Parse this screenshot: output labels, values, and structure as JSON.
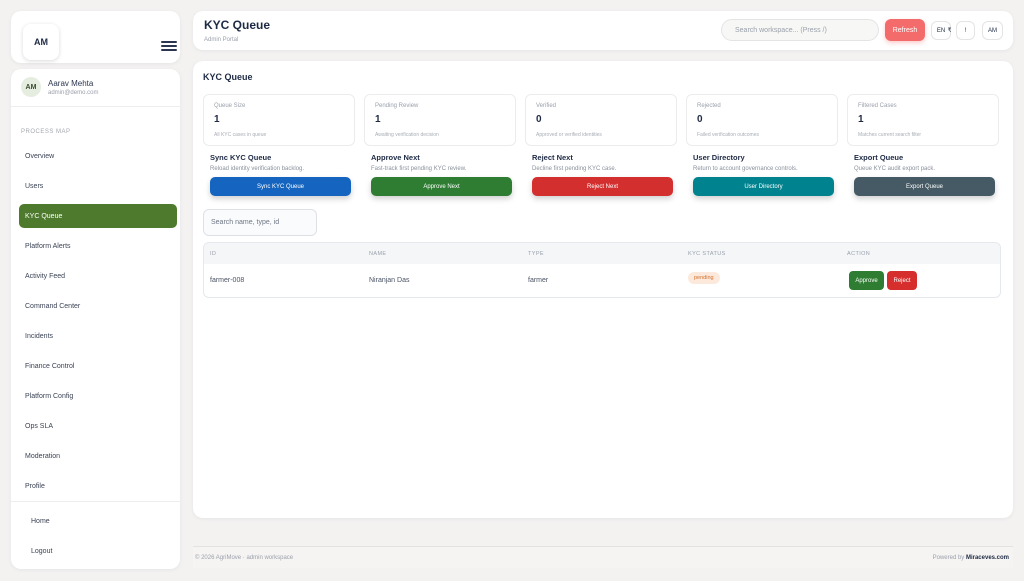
{
  "brand": {
    "logo_text": "AM"
  },
  "user": {
    "initials": "AM",
    "name": "Aarav Mehta",
    "email": "admin@demo.com"
  },
  "sidebar": {
    "section_label": "PROCESS MAP",
    "items": [
      {
        "label": "Overview"
      },
      {
        "label": "Users"
      },
      {
        "label": "KYC Queue"
      },
      {
        "label": "Platform Alerts"
      },
      {
        "label": "Activity Feed"
      },
      {
        "label": "Command Center"
      },
      {
        "label": "Incidents"
      },
      {
        "label": "Finance Control"
      },
      {
        "label": "Platform Config"
      },
      {
        "label": "Ops SLA"
      },
      {
        "label": "Moderation"
      },
      {
        "label": "Profile"
      }
    ],
    "active_item": "KYC Queue",
    "footer_items": [
      {
        "label": "Home"
      },
      {
        "label": "Logout"
      }
    ]
  },
  "header": {
    "title": "KYC Queue",
    "subtitle": "Admin Portal",
    "search_placeholder": "Search workspace... (Press /)",
    "refresh_label": "Refresh",
    "lang_label": "EN",
    "currency_label": "₹",
    "alert_label": "!",
    "avatar_initials": "AM"
  },
  "main": {
    "title": "KYC Queue",
    "stats": [
      {
        "label": "Queue Size",
        "value": "1",
        "desc": "All KYC cases in queue"
      },
      {
        "label": "Pending Review",
        "value": "1",
        "desc": "Awaiting verification decision"
      },
      {
        "label": "Verified",
        "value": "0",
        "desc": "Approved or verified identities"
      },
      {
        "label": "Rejected",
        "value": "0",
        "desc": "Failed verification outcomes"
      },
      {
        "label": "Filtered Cases",
        "value": "1",
        "desc": "Matches current search filter"
      }
    ],
    "actions": [
      {
        "title": "Sync KYC Queue",
        "desc": "Reload identity verification backlog.",
        "button": "Sync KYC Queue",
        "color": "#1565c0"
      },
      {
        "title": "Approve Next",
        "desc": "Fast-track first pending KYC review.",
        "button": "Approve Next",
        "color": "#2e7d32"
      },
      {
        "title": "Reject Next",
        "desc": "Decline first pending KYC case.",
        "button": "Reject Next",
        "color": "#d32f2f"
      },
      {
        "title": "User Directory",
        "desc": "Return to account governance controls.",
        "button": "User Directory",
        "color": "#00838f"
      },
      {
        "title": "Export Queue",
        "desc": "Queue KYC audit export pack.",
        "button": "Export Queue",
        "color": "#455a64"
      }
    ],
    "table_search_placeholder": "Search name, type, id",
    "table": {
      "headers": [
        "ID",
        "NAME",
        "TYPE",
        "KYC STATUS",
        "ACTION"
      ],
      "rows": [
        {
          "id": "farmer-008",
          "name": "Niranjan Das",
          "type": "farmer",
          "status": "pending",
          "approve": "Approve",
          "reject": "Reject"
        }
      ]
    }
  },
  "footer": {
    "copyright": "© 2026 AgriMove · admin workspace",
    "powered_prefix": "Powered by",
    "powered_brand": "Miraceves.com"
  }
}
